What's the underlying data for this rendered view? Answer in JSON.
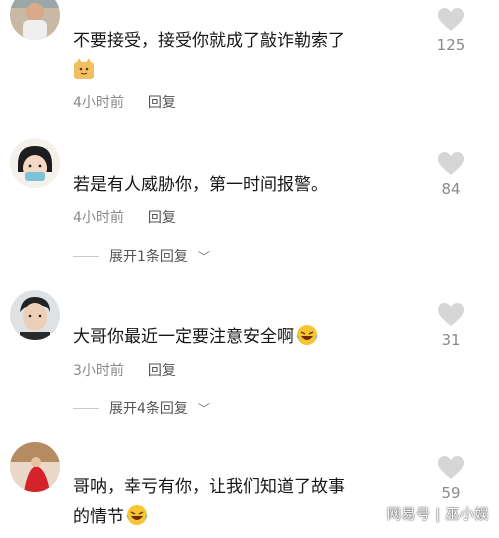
{
  "comments": [
    {
      "username": "",
      "text": "不要接受，接受你就成了敲诈勒索了",
      "emoji": "cat-face-emoji",
      "time": "4小时前",
      "reply_label": "回复",
      "likes": "125",
      "expand": ""
    },
    {
      "username": "",
      "text": "若是有人威胁你，第一时间报警。",
      "emoji": "",
      "time": "4小时前",
      "reply_label": "回复",
      "likes": "84",
      "expand": "展开1条回复"
    },
    {
      "username": "",
      "text": "大哥你最近一定要注意安全啊",
      "emoji": "laughing-tears-emoji",
      "time": "3小时前",
      "reply_label": "回复",
      "likes": "31",
      "expand": "展开4条回复"
    },
    {
      "username": "",
      "text_line1": "哥呐，幸亏有你，让我们知道了故事",
      "text_line2": "的情节",
      "emoji": "laughing-tears-emoji",
      "likes": "59"
    }
  ],
  "watermark": "网易号 | 巫小娱",
  "colors": {
    "heart": "#d6d6d6",
    "meta": "#8a8a8a",
    "text": "#161616"
  }
}
